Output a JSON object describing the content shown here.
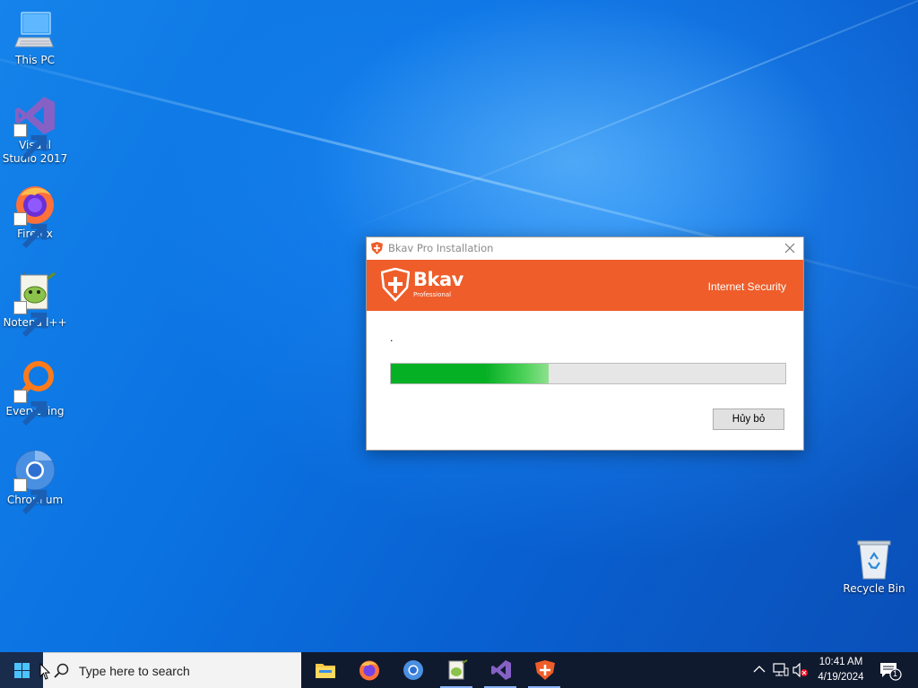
{
  "desktop": {
    "icons": [
      {
        "label": "This PC",
        "icon": "computer-icon"
      },
      {
        "label": "Visual Studio 2017",
        "icon": "visual-studio-icon"
      },
      {
        "label": "Firefox",
        "icon": "firefox-icon"
      },
      {
        "label": "Notepad++",
        "icon": "notepad-plus-plus-icon"
      },
      {
        "label": "Everything",
        "icon": "everything-search-icon"
      },
      {
        "label": "Chromium",
        "icon": "chromium-icon"
      },
      {
        "label": "Recycle Bin",
        "icon": "recycle-bin-icon"
      }
    ]
  },
  "dialog": {
    "title": "Bkav Pro Installation",
    "brand": "Bkav",
    "brand_sub": "Professional",
    "tagline": "Internet Security",
    "status": ".",
    "progress_fraction": 0.4,
    "cancel_label": "Hủy bỏ",
    "accent": "#ee5d2a",
    "progress_color": "#06b025"
  },
  "taskbar": {
    "search_placeholder": "Type here to search",
    "apps": [
      "file-explorer-icon",
      "firefox-icon",
      "chromium-icon",
      "notepad-plus-plus-icon",
      "visual-studio-icon",
      "bkav-icon"
    ],
    "time": "10:41 AM",
    "date": "4/19/2024",
    "notification_count": "1"
  }
}
